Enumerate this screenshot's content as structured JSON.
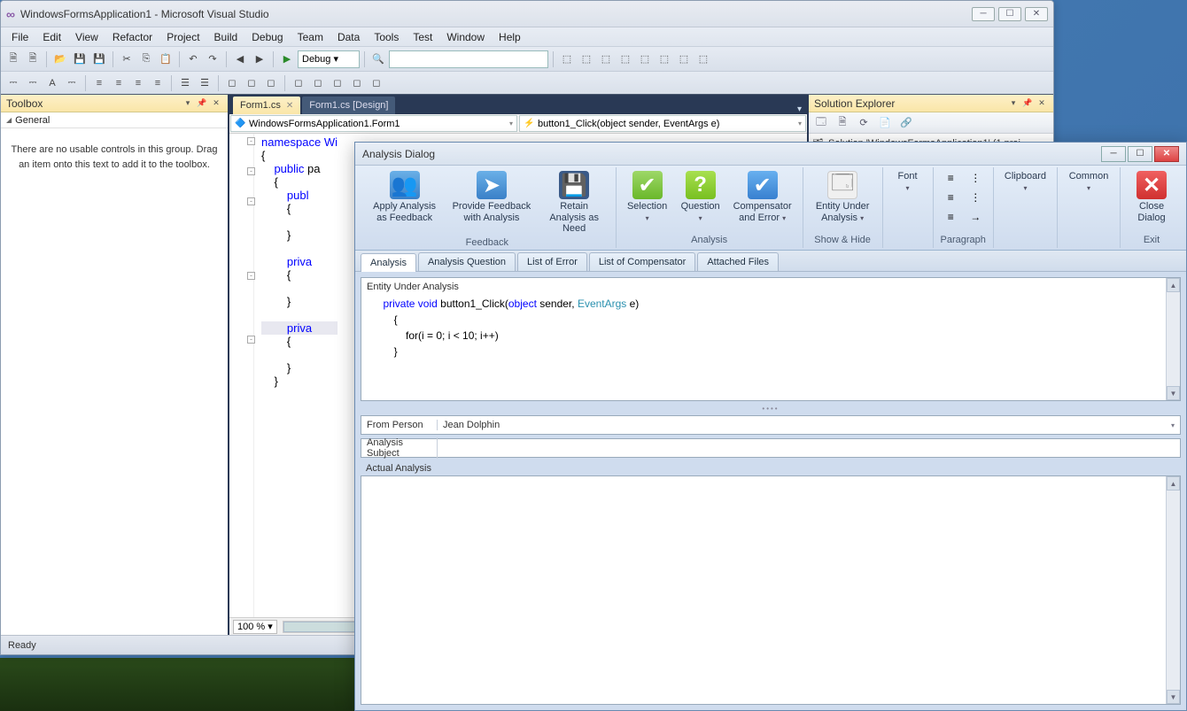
{
  "vs": {
    "title": "WindowsFormsApplication1 - Microsoft Visual Studio",
    "menu": [
      "File",
      "Edit",
      "View",
      "Refactor",
      "Project",
      "Build",
      "Debug",
      "Team",
      "Data",
      "Tools",
      "Test",
      "Window",
      "Help"
    ],
    "config": "Debug",
    "status": "Ready",
    "zoom": "100 %"
  },
  "toolbox": {
    "title": "Toolbox",
    "section": "General",
    "empty": "There are no usable controls in this group. Drag an item onto this text to add it to the toolbox."
  },
  "tabs": {
    "active": "Form1.cs",
    "inactive": "Form1.cs [Design]"
  },
  "nav": {
    "left": "WindowsFormsApplication1.Form1",
    "right": "button1_Click(object sender, EventArgs e)"
  },
  "code": {
    "l1": "namespace Wi",
    "l2": "{",
    "l3": "    public pa",
    "l4": "    {",
    "l5": "        publ",
    "l6": "        {",
    "l7": "",
    "l8": "        }",
    "l9": "",
    "l10": "        priva",
    "l11": "        {",
    "l12": "",
    "l13": "        }",
    "l14": "",
    "l15": "        priva",
    "l16": "        {",
    "l17": "",
    "l18": "        }",
    "l19": "    }"
  },
  "solution": {
    "title": "Solution Explorer",
    "root": "Solution 'WindowsFormsApplication1' (1 proj"
  },
  "dialog": {
    "title": "Analysis Dialog",
    "ribbon": {
      "apply": "Apply Analysis as Feedback",
      "provide": "Provide Feedback with Analysis",
      "retain": "Retain Analysis as Need",
      "selection": "Selection",
      "question": "Question",
      "compensator": "Compensator and Error",
      "entity": "Entity Under Analysis",
      "font": "Font",
      "clipboard": "Clipboard",
      "common": "Common",
      "close": "Close Dialog",
      "grp_feedback": "Feedback",
      "grp_analysis": "Analysis",
      "grp_showhide": "Show & Hide",
      "grp_paragraph": "Paragraph",
      "grp_exit": "Exit"
    },
    "tabs": [
      "Analysis",
      "Analysis Question",
      "List of Error",
      "List of Compensator",
      "Attached Files"
    ],
    "entity_label": "Entity Under Analysis",
    "code": {
      "sig_pre": "private void",
      "sig_name": " button1_Click(",
      "sig_obj": "object",
      "sig_mid": " sender, ",
      "sig_typ": "EventArgs",
      "sig_post": " e)",
      "brace_o": "        {",
      "body": "            for(i = 0; i < 10; i++)",
      "brace_c": "        }"
    },
    "from_label": "From Person",
    "from_value": "Jean Dolphin",
    "subject_label": "Analysis Subject",
    "subject_value": "",
    "actual_label": "Actual Analysis"
  }
}
